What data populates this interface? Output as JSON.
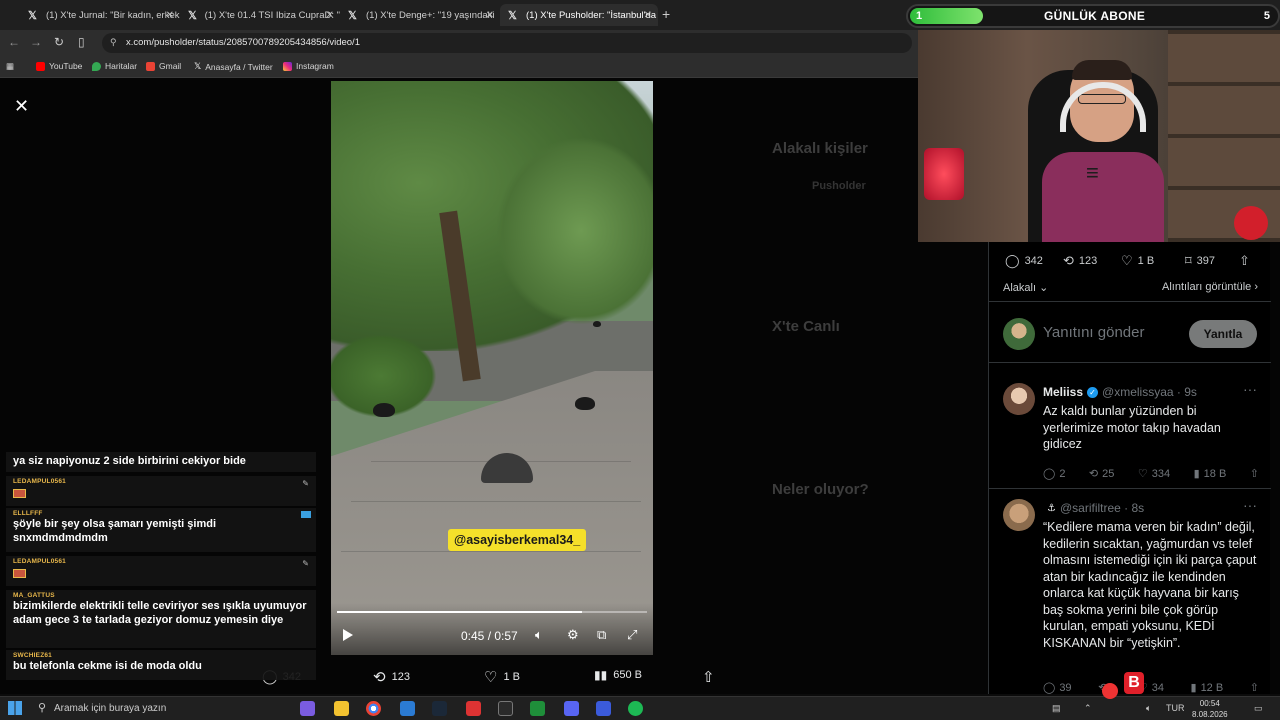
{
  "tabs": [
    {
      "title": "(1) X'te Jurnal: \"Bir kadın, erkek",
      "active": false
    },
    {
      "title": "(1) X'te 01.4 TSI Ibiza CupraD: \"",
      "active": false
    },
    {
      "title": "(1) X'te Denge+: \"19 yaşındaki",
      "active": false
    },
    {
      "title": "(1) X'te Pusholder: \"İstanbul'da",
      "active": true
    }
  ],
  "browser": {
    "url": "x.com/pusholder/status/2085700789205434856/video/1",
    "bookmarks": [
      "YouTube",
      "Haritalar",
      "Gmail",
      "Anasayfa / Twitter",
      "Instagram"
    ]
  },
  "video": {
    "watermark": "@asayisberkemal34_",
    "time": "0:45 / 0:57",
    "progress": 0.79
  },
  "post_actions": {
    "replies": "342",
    "reposts": "123",
    "likes": "1 B",
    "views": "650 B"
  },
  "chat": [
    {
      "name": "",
      "text": "ya siz napiyonuz 2 side birbirini cekiyor bide"
    },
    {
      "name": "LEDAMPUL0561",
      "text": ""
    },
    {
      "name": "ELLLFFF",
      "text": "şöyle bir şey olsa şamarı yemişti şimdi snxmdmdmdmdm"
    },
    {
      "name": "LEDAMPUL0561",
      "text": ""
    },
    {
      "name": "MA_GATTUS",
      "text": "bizimkilerde elektrikli telle ceviriyor ses ışıkla uyumuyor adam gece 3 te tarlada geziyor domuz yemesin diye"
    },
    {
      "name": "SWCHIEZ61",
      "text": "bu telefonla cekme isi de moda oldu"
    }
  ],
  "right_pane": {
    "stats": {
      "replies": "342",
      "reposts": "123",
      "likes": "1 B",
      "bookmarks": "397"
    },
    "sort_label": "Alakalı",
    "quotes_label": "Alıntıları görüntüle",
    "reply_placeholder": "Yanıtını gönder",
    "reply_button": "Yanıtla",
    "tweets": [
      {
        "name": "Meliiss",
        "verified": true,
        "handle": "@xmelissyaa · 9s",
        "body": "Az kaldı bunlar yüzünden bi yerlerimize motor takıp havadan gidicez",
        "replies": "2",
        "reposts": "25",
        "likes": "334",
        "views": "18 B"
      },
      {
        "name": "",
        "verified": false,
        "handle": "@sarifiltree · 8s",
        "body": "“Kedilere mama veren bir kadın” değil, kedilerin sıcaktan, yağmurdan vs telef olmasını istemediği için iki parça çaput atan bir kadıncağız ile kendinden onlarca kat küçük hayvana bir karış baş sokma yerini bile çok görüp kurulan, empati yoksunu, KEDİ KISKANAN bir “yetişkin”.",
        "replies": "39",
        "reposts": "",
        "likes": "34",
        "views": "12 B"
      }
    ]
  },
  "background_ghost": {
    "related_title": "Alakalı kişiler",
    "related_name": "Pusholder",
    "live_title": "X'te Canlı",
    "trending_title": "Neler oluyor?"
  },
  "overlay": {
    "sub_title": "GÜNLÜK ABONE",
    "sub_left": "1",
    "sub_right": "5",
    "sub_progress": 0.2
  },
  "taskbar": {
    "search_placeholder": "Aramak için buraya yazın",
    "lang": "TUR",
    "time": "00:54",
    "date": "8.08.2026"
  },
  "colors": {
    "accent": "#1d9bf0",
    "chat_name": "#e9b84b",
    "watermark_bg": "#f5e02a",
    "sub_fill": "#2fbd3b"
  }
}
